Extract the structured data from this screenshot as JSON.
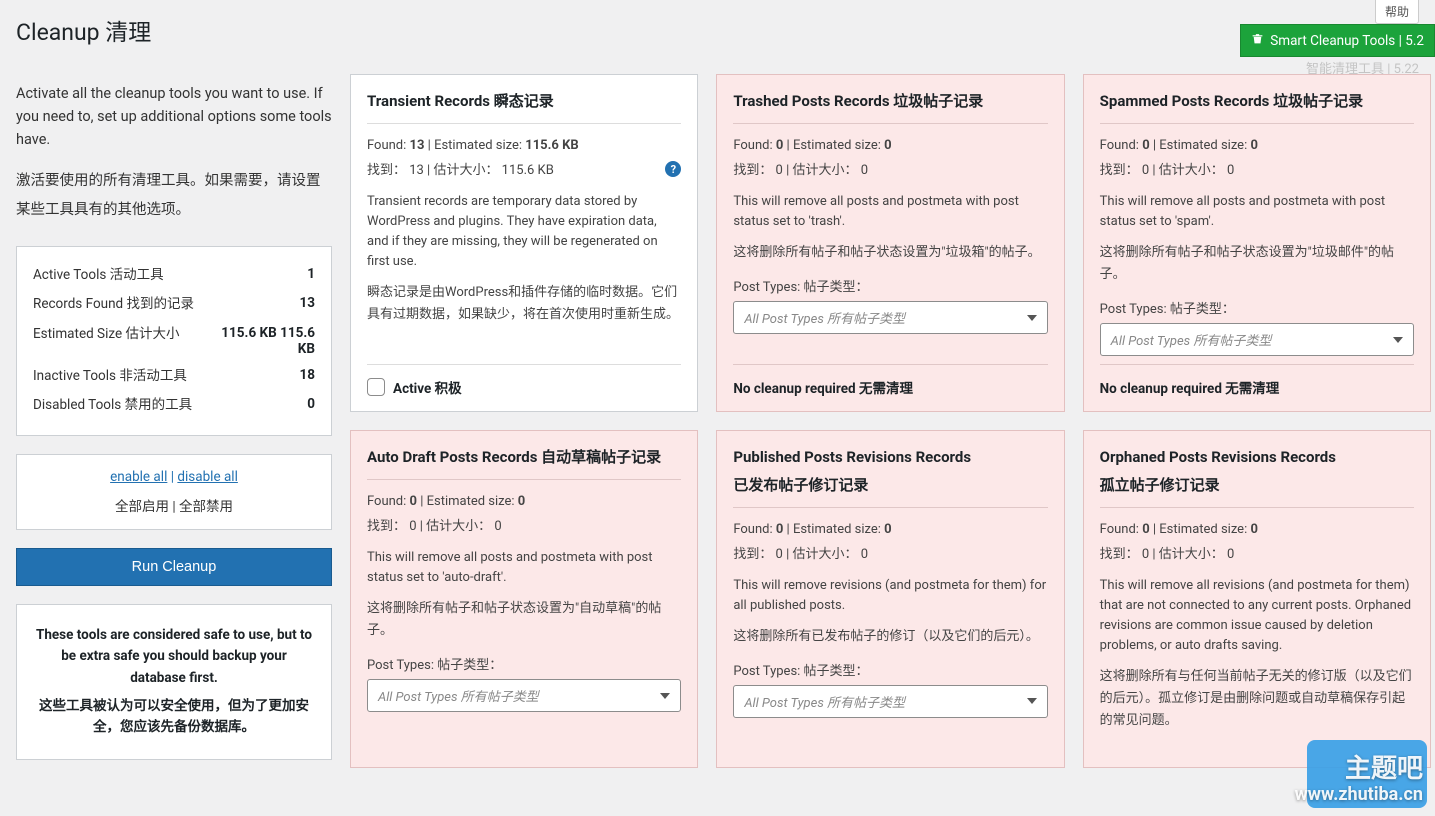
{
  "header": {
    "title": "Cleanup  清理",
    "help": "帮助",
    "badge_label": "Smart Cleanup Tools | 5.2",
    "badge_under": "智能清理工具 | 5.22"
  },
  "sidebar": {
    "intro_en": "Activate all the cleanup tools you want to use. If you need to, set up additional options some tools have.",
    "intro_cn": "激活要使用的所有清理工具。如果需要，请设置某些工具具有的其他选项。",
    "stats": [
      {
        "label": "Active Tools 活动工具",
        "val": "1"
      },
      {
        "label": "Records Found 找到的记录",
        "val": "13"
      },
      {
        "label": "Estimated Size 估计大小",
        "val": "115.6 KB 115.6 KB"
      },
      {
        "label": "Inactive Tools 非活动工具",
        "val": "18"
      },
      {
        "label": "Disabled Tools 禁用的工具",
        "val": "0"
      }
    ],
    "enable_all": "enable all",
    "disable_all": "disable all",
    "enable_all_cn": "全部启用",
    "disable_all_cn": "全部禁用",
    "run_btn": "Run Cleanup",
    "safe_en": "These tools are considered safe to use, but to be extra safe you should backup your database first.",
    "safe_cn": "这些工具被认为可以安全使用，但为了更加安全，您应该先备份数据库。"
  },
  "cards": [
    {
      "key": "transient",
      "pink": false,
      "title1": "Transient Records 瞬态记录",
      "title2": "",
      "found_label": "Found:",
      "found_val": "13",
      "est_label": "Estimated size:",
      "est_val": "115.6 KB",
      "found_cn": "找到：",
      "found_val_cn": "13",
      "est_cn": "估计大小：",
      "est_val_cn": "115.6 KB",
      "help_icon": true,
      "desc_en": "Transient records are temporary data stored by WordPress and plugins. They have expiration data, and if they are missing, they will be regenerated on first use.",
      "desc_cn": "瞬态记录是由WordPress和插件存储的临时数据。它们具有过期数据，如果缺少，将在首次使用时重新生成。",
      "post_types": false,
      "footer_type": "active",
      "footer_text": "Active 积极"
    },
    {
      "key": "trashed",
      "pink": true,
      "title1": "Trashed Posts Records 垃圾帖子记录",
      "title2": "",
      "found_label": "Found:",
      "found_val": "0",
      "est_label": "Estimated size:",
      "est_val": "0",
      "found_cn": "找到：",
      "found_val_cn": "0",
      "est_cn": "估计大小：",
      "est_val_cn": "0",
      "help_icon": false,
      "desc_en": "This will remove all posts and postmeta with post status set to 'trash'.",
      "desc_cn": "这将删除所有帖子和帖子状态设置为\"垃圾箱\"的帖子。",
      "post_types": true,
      "pt_en": "Post Types:",
      "pt_cn": "帖子类型：",
      "pt_placeholder": "All Post Types 所有帖子类型",
      "footer_type": "nocleanup",
      "footer_text": "No cleanup required 无需清理"
    },
    {
      "key": "spammed",
      "pink": true,
      "title1": "Spammed Posts Records 垃圾帖子记录",
      "title2": "",
      "found_label": "Found:",
      "found_val": "0",
      "est_label": "Estimated size:",
      "est_val": "0",
      "found_cn": "找到：",
      "found_val_cn": "0",
      "est_cn": "估计大小：",
      "est_val_cn": "0",
      "help_icon": false,
      "desc_en": "This will remove all posts and postmeta with post status set to 'spam'.",
      "desc_cn": "这将删除所有帖子和帖子状态设置为\"垃圾邮件\"的帖子。",
      "post_types": true,
      "pt_en": "Post Types:",
      "pt_cn": "帖子类型：",
      "pt_placeholder": "All Post Types 所有帖子类型",
      "footer_type": "nocleanup",
      "footer_text": "No cleanup required 无需清理"
    },
    {
      "key": "autodraft",
      "pink": true,
      "title1": "Auto Draft Posts Records 自动草稿帖子记录",
      "title2": "",
      "found_label": "Found:",
      "found_val": "0",
      "est_label": "Estimated size:",
      "est_val": "0",
      "found_cn": "找到：",
      "found_val_cn": "0",
      "est_cn": "估计大小：",
      "est_val_cn": "0",
      "help_icon": false,
      "desc_en": "This will remove all posts and postmeta with post status set to 'auto-draft'.",
      "desc_cn": "这将删除所有帖子和帖子状态设置为\"自动草稿\"的帖子。",
      "post_types": true,
      "pt_en": "Post Types:",
      "pt_cn": "帖子类型：",
      "pt_placeholder": "All Post Types 所有帖子类型",
      "footer_type": "none",
      "footer_text": ""
    },
    {
      "key": "published-rev",
      "pink": true,
      "title1": "Published Posts Revisions Records",
      "title2": "已发布帖子修订记录",
      "found_label": "Found:",
      "found_val": "0",
      "est_label": "Estimated size:",
      "est_val": "0",
      "found_cn": "找到：",
      "found_val_cn": "0",
      "est_cn": "估计大小：",
      "est_val_cn": "0",
      "help_icon": false,
      "desc_en": "This will remove revisions (and postmeta for them) for all published posts.",
      "desc_cn": "这将删除所有已发布帖子的修订（以及它们的后元）。",
      "post_types": true,
      "pt_en": "Post Types:",
      "pt_cn": "帖子类型：",
      "pt_placeholder": "All Post Types 所有帖子类型",
      "footer_type": "none",
      "footer_text": ""
    },
    {
      "key": "orphaned-rev",
      "pink": true,
      "title1": "Orphaned Posts Revisions Records",
      "title2": "孤立帖子修订记录",
      "found_label": "Found:",
      "found_val": "0",
      "est_label": "Estimated size:",
      "est_val": "0",
      "found_cn": "找到：",
      "found_val_cn": "0",
      "est_cn": "估计大小：",
      "est_val_cn": "0",
      "help_icon": false,
      "desc_en": "This will remove all revisions (and postmeta for them) that are not connected to any current posts. Orphaned revisions are common issue caused by deletion problems, or auto drafts saving.",
      "desc_cn": "这将删除所有与任何当前帖子无关的修订版（以及它们的后元）。孤立修订是由删除问题或自动草稿保存引起的常见问题。",
      "post_types": false,
      "footer_type": "none",
      "footer_text": ""
    }
  ],
  "watermark": {
    "big": "主题吧",
    "url": "www.zhutiba.cn"
  }
}
